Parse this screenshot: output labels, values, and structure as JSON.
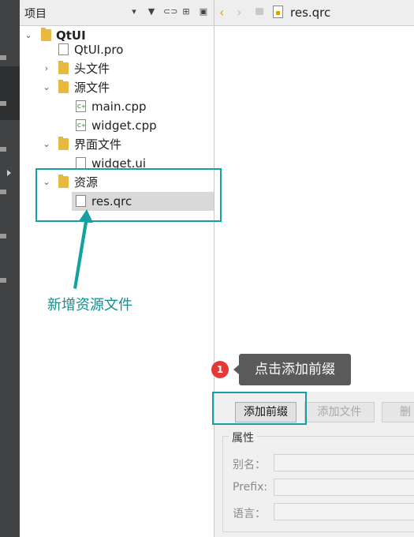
{
  "project_panel": {
    "title": "项目"
  },
  "tree": {
    "root": "QtUI",
    "pro_file": "QtUI.pro",
    "headers": "头文件",
    "sources": "源文件",
    "sources_files": [
      "main.cpp",
      "widget.cpp"
    ],
    "forms": "界面文件",
    "forms_files": [
      "widget.ui"
    ],
    "resources": "资源",
    "resources_files": [
      "res.qrc"
    ]
  },
  "editor": {
    "file_tab": "res.qrc"
  },
  "buttons": {
    "add_prefix": "添加前缀",
    "add_file": "添加文件",
    "remove": "删"
  },
  "properties": {
    "title": "属性",
    "alias": "别名：",
    "prefix": "Prefix:",
    "language": "语言："
  },
  "annotations": {
    "new_resource": "新增资源文件",
    "step_number": "1",
    "click_add_prefix": "点击添加前缀"
  },
  "colors": {
    "annotation": "#15a1a0",
    "badge": "#e53935",
    "selection": "#d9d9d9"
  }
}
